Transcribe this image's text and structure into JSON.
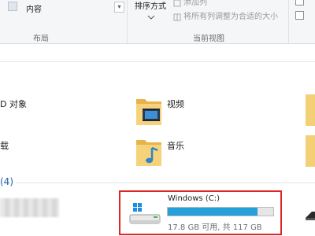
{
  "ribbon": {
    "content_item": "内容",
    "layout_group": "布局",
    "sort_by": "排序方式",
    "sort_cut_text": "添加列",
    "fit_columns": "将所有列调整为合适的大小",
    "current_view_group": "当前视图"
  },
  "folders": {
    "objects_fragment": "D 对象",
    "videos": "视频",
    "downloads_fragment": "载",
    "music": "音乐"
  },
  "devices_section": {
    "count_fragment": "(4)"
  },
  "drive": {
    "name": "Windows (C:)",
    "free_text": "17.8 GB 可用, 共 117 GB",
    "used_fraction": 0.848
  },
  "colors": {
    "accent": "#26a0da",
    "highlight_border": "#e02727",
    "folder_yellow": "#f2c75c"
  },
  "icons": {
    "folder": "folder-icon",
    "video_folder": "video-folder-icon",
    "music_folder": "music-folder-icon",
    "windows_drive": "windows-drive-icon"
  }
}
